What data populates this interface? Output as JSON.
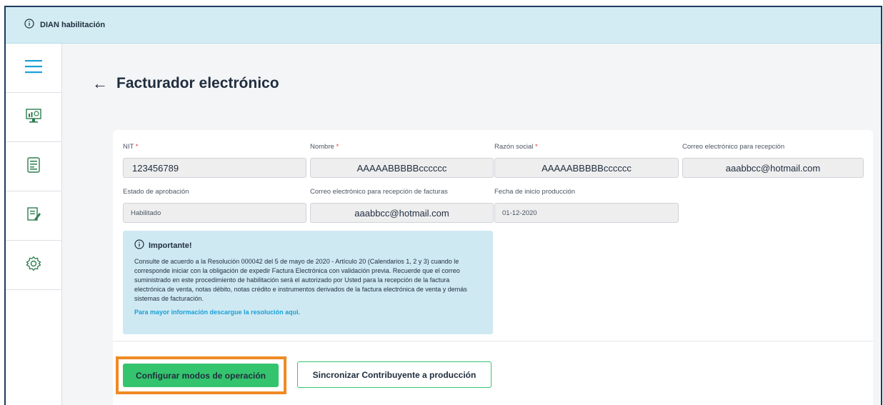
{
  "topbar": {
    "environment": "DIAN habilitación",
    "info_icon": "info-circle-icon"
  },
  "sidebar": {
    "items": [
      {
        "icon": "hamburger-menu-icon",
        "color": "#1aa0d6"
      },
      {
        "icon": "dashboard-monitor-icon"
      },
      {
        "icon": "document-icon"
      },
      {
        "icon": "edit-document-icon"
      },
      {
        "icon": "gear-icon"
      }
    ]
  },
  "page": {
    "back_icon": "←",
    "title": "Facturador electrónico"
  },
  "form": {
    "nit": {
      "label": "NIT",
      "required": "*",
      "value": "123456789"
    },
    "nombre": {
      "label": "Nombre",
      "required": "*",
      "value": "AAAAABBBBBcccccc"
    },
    "razon_social": {
      "label": "Razón social",
      "required": "*",
      "value": "AAAAABBBBBcccccc"
    },
    "correo_recepcion": {
      "label": "Correo electrónico para recepción",
      "value": "aaabbcc@hotmail.com"
    },
    "estado": {
      "label": "Estado de aprobación",
      "value": "Habilitado"
    },
    "correo_facturas": {
      "label": "Correo electrónico para recepción de facturas",
      "value": "aaabbcc@hotmail.com"
    },
    "fecha_inicio": {
      "label": "Fecha de inicio producción",
      "value": "01-12-2020"
    }
  },
  "notice": {
    "title": "Importante!",
    "body": "Consulte de acuerdo a la Resolución 000042 del 5 de mayo de 2020 - Artículo 20 (Calendarios 1, 2 y 3) cuando le corresponde iniciar con la obligación de expedir Factura Electrónica con validación previa. Recuerde que el correo suministrado en este procedimiento de habilitación será el autorizado por Usted para la recepción de la factura electrónica de venta, notas débito, notas crédito e instrumentos derivados de la factura electrónica de venta y demás sistemas de facturación.",
    "link": "Para mayor información descargue la resolución aqui."
  },
  "actions": {
    "primary_label": "Configurar modos de operación",
    "secondary_label": "Sincronizar Contribuyente a producción"
  },
  "colors": {
    "topbar_bg": "#d3ecf4",
    "accent_green": "#35c46e",
    "accent_blue": "#1aa0d6",
    "highlight_orange": "#f08a24",
    "frame_border": "#1e3a5f"
  }
}
